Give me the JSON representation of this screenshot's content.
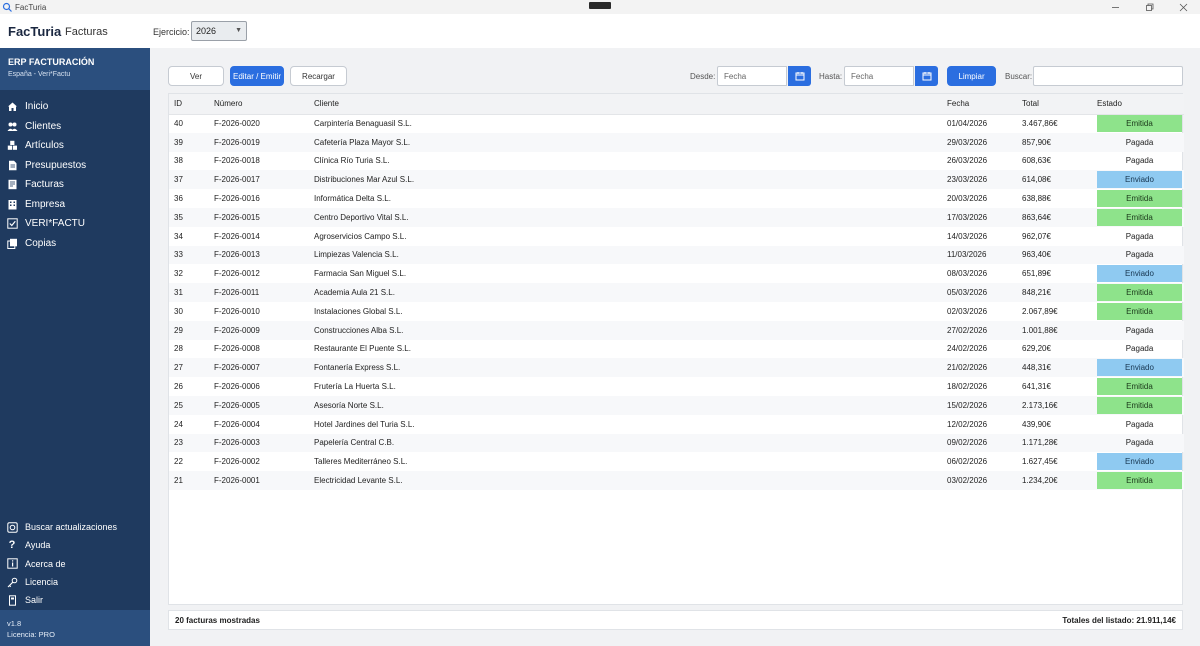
{
  "window": {
    "title": "FacTuria"
  },
  "header": {
    "brand": "FacTuria",
    "section": "Facturas",
    "ejercicio_label": "Ejercicio:",
    "ejercicio_value": "2026"
  },
  "sidebar": {
    "title": "ERP FACTURACIÓN",
    "subtitle": "España - Veri*Factu",
    "items": [
      {
        "label": "Inicio",
        "icon": "home-icon"
      },
      {
        "label": "Clientes",
        "icon": "users-icon"
      },
      {
        "label": "Artículos",
        "icon": "cubes-icon"
      },
      {
        "label": "Presupuestos",
        "icon": "document-icon"
      },
      {
        "label": "Facturas",
        "icon": "invoice-icon"
      },
      {
        "label": "Empresa",
        "icon": "building-icon"
      },
      {
        "label": "VERI*FACTU",
        "icon": "check-icon"
      },
      {
        "label": "Copias",
        "icon": "copy-icon"
      }
    ],
    "bottom_items": [
      {
        "label": "Buscar actualizaciones",
        "icon": "update-icon"
      },
      {
        "label": "Ayuda",
        "icon": "help-icon"
      },
      {
        "label": "Acerca de",
        "icon": "info-icon"
      },
      {
        "label": "Licencia",
        "icon": "key-icon"
      },
      {
        "label": "Salir",
        "icon": "exit-icon"
      }
    ],
    "version": "v1.8",
    "license": "Licencia: PRO"
  },
  "toolbar": {
    "ver": "Ver",
    "editar": "Editar / Emitir",
    "recargar": "Recargar",
    "desde_label": "Desde:",
    "desde_placeholder": "Fecha",
    "hasta_label": "Hasta:",
    "hasta_placeholder": "Fecha",
    "limpiar": "Limpiar",
    "buscar_label": "Buscar:"
  },
  "table": {
    "columns": [
      "ID",
      "Número",
      "Cliente",
      "Fecha",
      "Total",
      "Estado"
    ],
    "rows": [
      {
        "id": "40",
        "numero": "F-2026-0020",
        "cliente": "Carpintería Benaguasil S.L.",
        "fecha": "01/04/2026",
        "total": "3.467,86€",
        "estado": "Emitida"
      },
      {
        "id": "39",
        "numero": "F-2026-0019",
        "cliente": "Cafetería Plaza Mayor S.L.",
        "fecha": "29/03/2026",
        "total": "857,90€",
        "estado": "Pagada"
      },
      {
        "id": "38",
        "numero": "F-2026-0018",
        "cliente": "Clínica Río Turia S.L.",
        "fecha": "26/03/2026",
        "total": "608,63€",
        "estado": "Pagada"
      },
      {
        "id": "37",
        "numero": "F-2026-0017",
        "cliente": "Distribuciones Mar Azul S.L.",
        "fecha": "23/03/2026",
        "total": "614,08€",
        "estado": "Enviado"
      },
      {
        "id": "36",
        "numero": "F-2026-0016",
        "cliente": "Informática Delta S.L.",
        "fecha": "20/03/2026",
        "total": "638,88€",
        "estado": "Emitida"
      },
      {
        "id": "35",
        "numero": "F-2026-0015",
        "cliente": "Centro Deportivo Vital S.L.",
        "fecha": "17/03/2026",
        "total": "863,64€",
        "estado": "Emitida"
      },
      {
        "id": "34",
        "numero": "F-2026-0014",
        "cliente": "Agroservicios Campo S.L.",
        "fecha": "14/03/2026",
        "total": "962,07€",
        "estado": "Pagada"
      },
      {
        "id": "33",
        "numero": "F-2026-0013",
        "cliente": "Limpiezas Valencia S.L.",
        "fecha": "11/03/2026",
        "total": "963,40€",
        "estado": "Pagada"
      },
      {
        "id": "32",
        "numero": "F-2026-0012",
        "cliente": "Farmacia San Miguel S.L.",
        "fecha": "08/03/2026",
        "total": "651,89€",
        "estado": "Enviado"
      },
      {
        "id": "31",
        "numero": "F-2026-0011",
        "cliente": "Academia Aula 21 S.L.",
        "fecha": "05/03/2026",
        "total": "848,21€",
        "estado": "Emitida"
      },
      {
        "id": "30",
        "numero": "F-2026-0010",
        "cliente": "Instalaciones Global S.L.",
        "fecha": "02/03/2026",
        "total": "2.067,89€",
        "estado": "Emitida"
      },
      {
        "id": "29",
        "numero": "F-2026-0009",
        "cliente": "Construcciones Alba S.L.",
        "fecha": "27/02/2026",
        "total": "1.001,88€",
        "estado": "Pagada"
      },
      {
        "id": "28",
        "numero": "F-2026-0008",
        "cliente": "Restaurante El Puente S.L.",
        "fecha": "24/02/2026",
        "total": "629,20€",
        "estado": "Pagada"
      },
      {
        "id": "27",
        "numero": "F-2026-0007",
        "cliente": "Fontanería Express S.L.",
        "fecha": "21/02/2026",
        "total": "448,31€",
        "estado": "Enviado"
      },
      {
        "id": "26",
        "numero": "F-2026-0006",
        "cliente": "Frutería La Huerta S.L.",
        "fecha": "18/02/2026",
        "total": "641,31€",
        "estado": "Emitida"
      },
      {
        "id": "25",
        "numero": "F-2026-0005",
        "cliente": "Asesoría Norte S.L.",
        "fecha": "15/02/2026",
        "total": "2.173,16€",
        "estado": "Emitida"
      },
      {
        "id": "24",
        "numero": "F-2026-0004",
        "cliente": "Hotel Jardines del Turia S.L.",
        "fecha": "12/02/2026",
        "total": "439,90€",
        "estado": "Pagada"
      },
      {
        "id": "23",
        "numero": "F-2026-0003",
        "cliente": "Papelería Central C.B.",
        "fecha": "09/02/2026",
        "total": "1.171,28€",
        "estado": "Pagada"
      },
      {
        "id": "22",
        "numero": "F-2026-0002",
        "cliente": "Talleres Mediterráneo S.L.",
        "fecha": "06/02/2026",
        "total": "1.627,45€",
        "estado": "Enviado"
      },
      {
        "id": "21",
        "numero": "F-2026-0001",
        "cliente": "Electricidad Levante S.L.",
        "fecha": "03/02/2026",
        "total": "1.234,20€",
        "estado": "Emitida"
      }
    ]
  },
  "status": {
    "count_text": "20 facturas mostradas",
    "totals_text": "Totales del listado: 21.911,14€"
  },
  "colors": {
    "sidebar_bg": "#1f3a5f",
    "sidebar_head_bg": "#2b4f7e",
    "primary": "#2b6ee0",
    "emitida": "#8ee38b",
    "enviado": "#8fcaf1"
  }
}
